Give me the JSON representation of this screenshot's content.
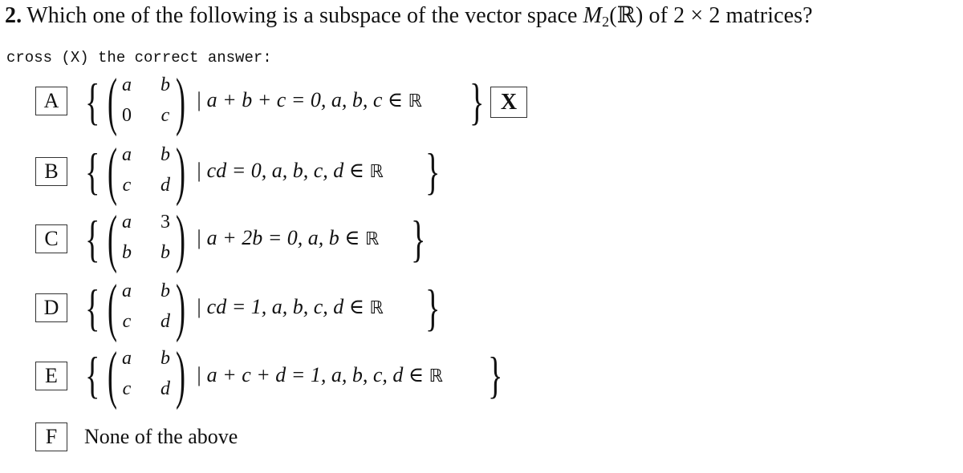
{
  "question": {
    "number": "2.",
    "text_before": "Which one of the following is a subspace of the vector space ",
    "space_symbol": "M",
    "space_subscript": "2",
    "space_field": "(ℝ)",
    "text_after": " of 2 × 2 matrices?"
  },
  "instruction": "cross (X) the correct answer:",
  "cross_mark": "X",
  "selected_option": "A",
  "options": [
    {
      "label": "A",
      "matrix": [
        "a",
        "b",
        "0",
        "c"
      ],
      "condition": "| a + b + c = 0,  a, b, c ∈ ",
      "field": "ℝ",
      "crossed": true
    },
    {
      "label": "B",
      "matrix": [
        "a",
        "b",
        "c",
        "d"
      ],
      "condition": "| cd = 0,  a, b, c, d ∈ ",
      "field": "ℝ",
      "crossed": false
    },
    {
      "label": "C",
      "matrix": [
        "a",
        "3",
        "b",
        "b"
      ],
      "condition": "| a + 2b = 0,  a, b ∈ ",
      "field": "ℝ",
      "crossed": false
    },
    {
      "label": "D",
      "matrix": [
        "a",
        "b",
        "c",
        "d"
      ],
      "condition": "| cd = 1,  a, b, c, d ∈ ",
      "field": "ℝ",
      "crossed": false
    },
    {
      "label": "E",
      "matrix": [
        "a",
        "b",
        "c",
        "d"
      ],
      "condition": "| a + c + d = 1,  a, b, c, d ∈ ",
      "field": "ℝ",
      "crossed": false
    },
    {
      "label": "F",
      "text": "None of the above",
      "crossed": false
    }
  ],
  "symbols": {
    "brace_open": "{",
    "brace_close": "}",
    "paren_open": "(",
    "paren_close": ")"
  }
}
